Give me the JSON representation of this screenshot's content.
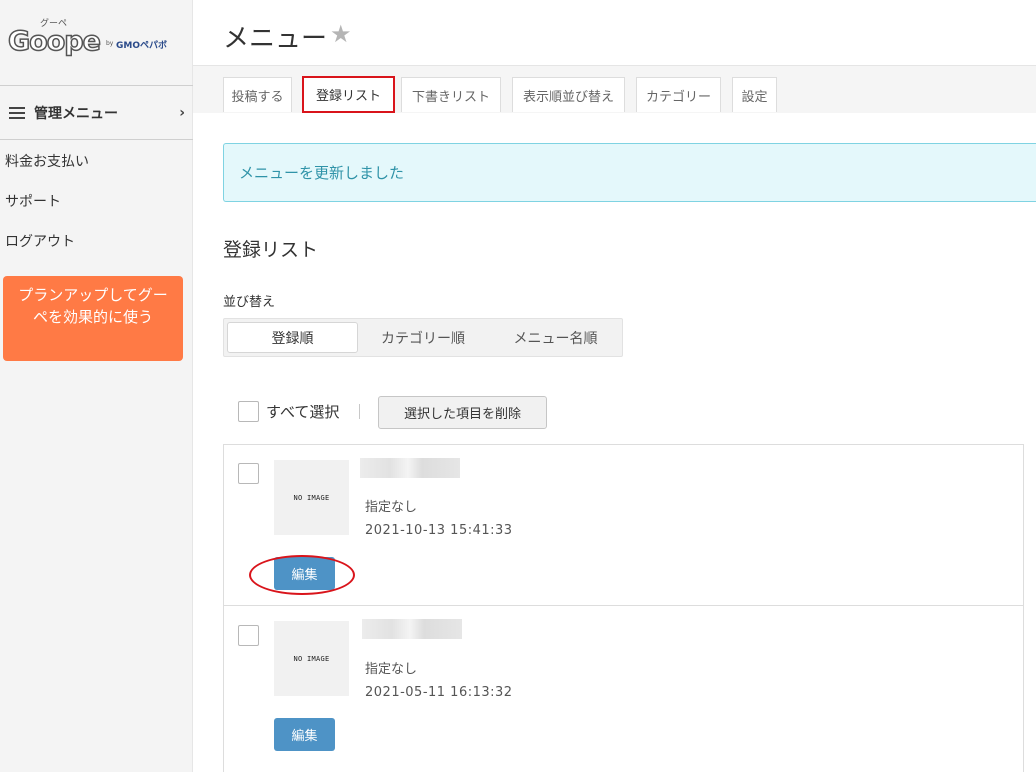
{
  "sidebar": {
    "logo": {
      "main": "Goope",
      "kana": "グーペ",
      "by": "by",
      "gmo": "GMOペパボ"
    },
    "menu_header": "管理メニュー",
    "links": [
      "料金お支払い",
      "サポート",
      "ログアウト"
    ],
    "plan_button": "プランアップしてグーペを効果的に使う"
  },
  "header": {
    "title": "メニュー"
  },
  "tabs": [
    "投稿する",
    "登録リスト",
    "下書きリスト",
    "表示順並び替え",
    "カテゴリー",
    "設定"
  ],
  "active_tab": "登録リスト",
  "alert": "メニューを更新しました",
  "section_title": "登録リスト",
  "sort": {
    "label": "並び替え",
    "options": [
      "登録順",
      "カテゴリー順",
      "メニュー名順"
    ],
    "selected": "登録順"
  },
  "bulk": {
    "select_all_label": "すべて選択",
    "delete_label": "選択した項目を削除"
  },
  "items": [
    {
      "thumbnail_text": "NO IMAGE",
      "category": "指定なし",
      "date": "2021-10-13 15:41:33",
      "edit_label": "編集"
    },
    {
      "thumbnail_text": "NO IMAGE",
      "category": "指定なし",
      "date": "2021-05-11 16:13:32",
      "edit_label": "編集"
    }
  ],
  "colors": {
    "accent_orange": "#ff7a45",
    "edit_blue": "#4e93c6",
    "alert_text": "#2f93a8",
    "alert_bg": "#e4f8fb",
    "highlight_red": "#d9141b"
  }
}
